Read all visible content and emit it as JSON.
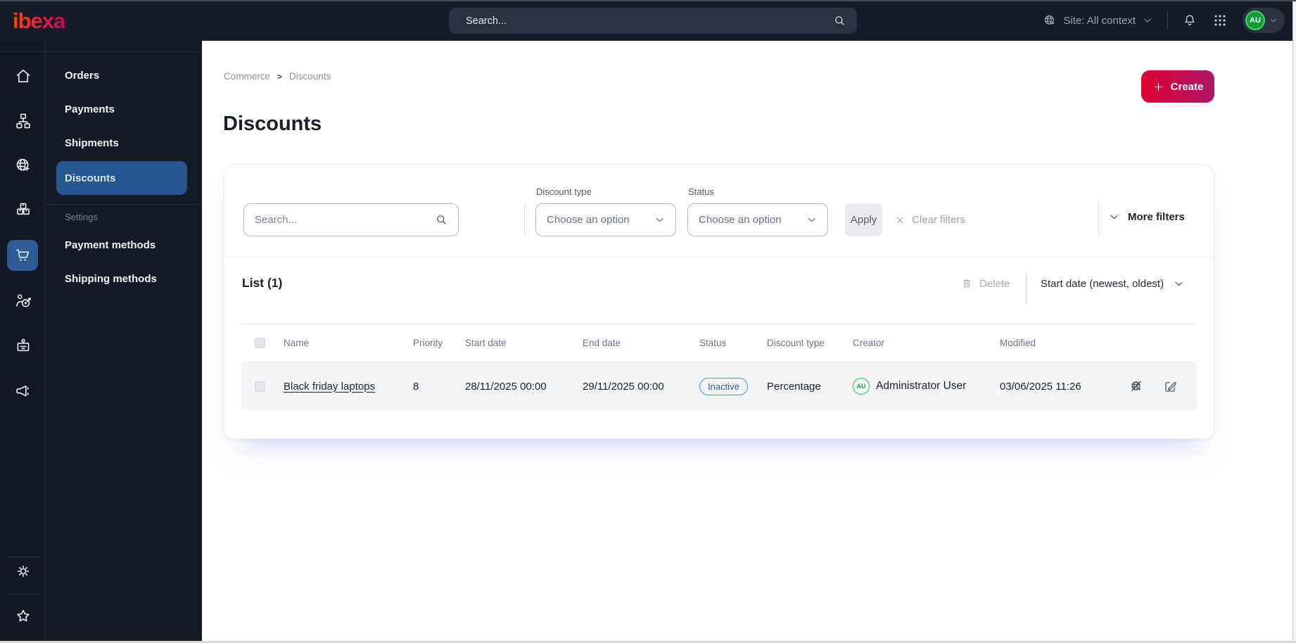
{
  "topbar": {
    "brand": "ibexa",
    "search_placeholder": "Search...",
    "site_selector_label": "Site: All context",
    "avatar_initials": "AU",
    "icons": [
      "globe-cursor-icon",
      "bell-icon",
      "app-grid-icon",
      "chevron-down-icon"
    ]
  },
  "icon_rail": {
    "items": [
      {
        "icon": "home-icon",
        "active": false
      },
      {
        "icon": "content-tree-icon",
        "active": false
      },
      {
        "icon": "site-globe-icon",
        "active": false
      },
      {
        "icon": "product-boxes-icon",
        "active": false
      },
      {
        "icon": "commerce-cart-icon",
        "active": true
      },
      {
        "icon": "customer-target-icon",
        "active": false
      },
      {
        "icon": "corporate-badge-icon",
        "active": false
      },
      {
        "icon": "campaign-megaphone-icon",
        "active": false
      }
    ],
    "bottom_items": [
      {
        "icon": "gear-icon"
      },
      {
        "icon": "star-icon"
      }
    ]
  },
  "sidebar": {
    "items": [
      {
        "label": "Orders",
        "active": false
      },
      {
        "label": "Payments",
        "active": false
      },
      {
        "label": "Shipments",
        "active": false
      },
      {
        "label": "Discounts",
        "active": true
      }
    ],
    "section_label": "Settings",
    "settings_items": [
      {
        "label": "Payment methods"
      },
      {
        "label": "Shipping methods"
      }
    ]
  },
  "breadcrumb": {
    "items": [
      "Commerce",
      "Discounts"
    ],
    "separator": ">"
  },
  "page": {
    "title": "Discounts",
    "create_label": "Create"
  },
  "filters": {
    "search_placeholder": "Search...",
    "discount_type_label": "Discount type",
    "discount_type_value": "Choose an option",
    "status_label": "Status",
    "status_value": "Choose an option",
    "apply_label": "Apply",
    "clear_label": "Clear filters",
    "more_filters_label": "More filters"
  },
  "list": {
    "title": "List (1)",
    "delete_label": "Delete",
    "sort_label": "Start date (newest, oldest)",
    "columns": [
      "Name",
      "Priority",
      "Start date",
      "End date",
      "Status",
      "Discount type",
      "Creator",
      "Modified"
    ],
    "rows": [
      {
        "name": "Black friday laptops",
        "priority": "8",
        "start_date": "28/11/2025 00:00",
        "end_date": "29/11/2025 00:00",
        "status": "Inactive",
        "discount_type": "Percentage",
        "creator": "Administrator User",
        "creator_initials": "AU",
        "modified": "03/06/2025 11:26",
        "action_icons": [
          "preview-on-site-disabled-icon",
          "edit-icon"
        ]
      }
    ]
  },
  "colors": {
    "topbar_bg": "#151c28",
    "sidebar_bg": "#141b27",
    "active_blue": "#25568f",
    "brand_gradient_start": "#ff4d00",
    "brand_gradient_end": "#c10560",
    "create_gradient_start": "#e00034",
    "create_gradient_end": "#ae1767",
    "badge_blue": "#4d92d8",
    "avatar_green": "#2fbd52"
  }
}
